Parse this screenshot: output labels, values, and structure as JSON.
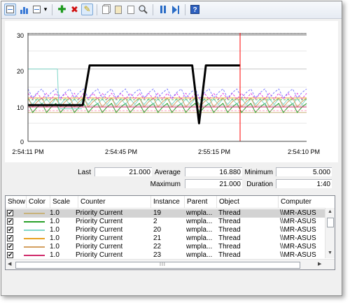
{
  "toolbar": {
    "buttons": [
      {
        "name": "view-graph-icon",
        "glyph": ""
      },
      {
        "name": "view-histogram-icon",
        "glyph": ""
      },
      {
        "name": "change-graph-type-icon",
        "glyph": ""
      },
      {
        "name": "dropdown-arrow-icon",
        "glyph": "▾"
      },
      {
        "name": "add-counter-icon",
        "glyph": "✚"
      },
      {
        "name": "delete-counter-icon",
        "glyph": "✖"
      },
      {
        "name": "highlight-icon",
        "glyph": "✎"
      },
      {
        "name": "copy-properties-icon",
        "glyph": ""
      },
      {
        "name": "paste-counter-list-icon",
        "glyph": ""
      },
      {
        "name": "properties-icon",
        "glyph": ""
      },
      {
        "name": "zoom-icon",
        "glyph": ""
      },
      {
        "name": "freeze-display-icon",
        "glyph": ""
      },
      {
        "name": "update-data-icon",
        "glyph": ""
      },
      {
        "name": "help-icon",
        "glyph": "?"
      }
    ],
    "colors": {
      "add": "#1e9a1e",
      "delete": "#d01010",
      "highlight": "#c8a000"
    }
  },
  "graph": {
    "y_ticks": [
      "30",
      "20",
      "10",
      "0"
    ],
    "x_ticks": [
      "2:54:11 PM",
      "2:54:45 PM",
      "2:55:15 PM",
      "2:54:10 PM"
    ],
    "time_bar_color": "#ff0000"
  },
  "chart_data": {
    "type": "line",
    "ylim": [
      0,
      30
    ],
    "grid": true,
    "x_tick_labels": [
      "2:54:11 PM",
      "2:54:45 PM",
      "2:55:15 PM",
      "2:54:10 PM"
    ],
    "highlighted_series": {
      "name": "19",
      "color": "#000000",
      "samples": [
        10,
        10,
        10,
        10,
        10,
        10,
        10,
        10,
        10,
        21,
        21,
        21,
        21,
        21,
        21,
        21,
        21,
        21,
        21,
        21,
        21,
        21,
        21,
        21,
        21,
        5,
        21,
        21,
        21,
        21,
        21,
        21
      ]
    }
  },
  "stats": {
    "last_label": "Last",
    "last_value": "21.000",
    "average_label": "Average",
    "average_value": "16.880",
    "minimum_label": "Minimum",
    "minimum_value": "5.000",
    "maximum_label": "Maximum",
    "maximum_value": "21.000",
    "duration_label": "Duration",
    "duration_value": "1:40"
  },
  "counter_list": {
    "columns": [
      "Show",
      "Color",
      "Scale",
      "Counter",
      "Instance",
      "Parent",
      "Object",
      "Computer"
    ],
    "rows": [
      {
        "show": "✔",
        "color": "#c8b27a",
        "scale": "1.0",
        "counter": "Priority Current",
        "instance": "19",
        "parent": "wmpla...",
        "object": "Thread",
        "computer": "\\\\MR-ASUS"
      },
      {
        "show": "✔",
        "color": "#2aa02a",
        "scale": "1.0",
        "counter": "Priority Current",
        "instance": "2",
        "parent": "wmpla...",
        "object": "Thread",
        "computer": "\\\\MR-ASUS"
      },
      {
        "show": "✔",
        "color": "#7fd6c8",
        "scale": "1.0",
        "counter": "Priority Current",
        "instance": "20",
        "parent": "wmpla...",
        "object": "Thread",
        "computer": "\\\\MR-ASUS"
      },
      {
        "show": "✔",
        "color": "#e8a020",
        "scale": "1.0",
        "counter": "Priority Current",
        "instance": "21",
        "parent": "wmpla...",
        "object": "Thread",
        "computer": "\\\\MR-ASUS"
      },
      {
        "show": "✔",
        "color": "#d4a060",
        "scale": "1.0",
        "counter": "Priority Current",
        "instance": "22",
        "parent": "wmpla...",
        "object": "Thread",
        "computer": "\\\\MR-ASUS"
      },
      {
        "show": "✔",
        "color": "#d02a6a",
        "scale": "1.0",
        "counter": "Priority Current",
        "instance": "23",
        "parent": "wmpla...",
        "object": "Thread",
        "computer": "\\\\MR-ASUS"
      }
    ],
    "scroll_grip": "III"
  }
}
